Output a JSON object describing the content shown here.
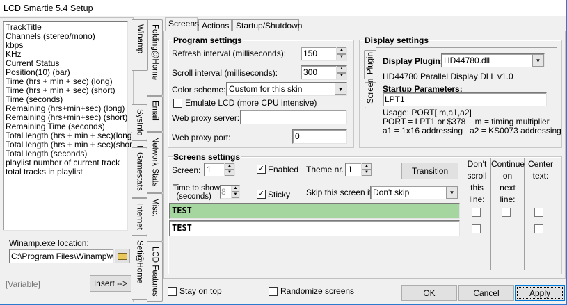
{
  "window": {
    "title": "LCD Smartie 5.4 Setup"
  },
  "left_panel": {
    "variables": [
      "TrackTitle",
      "Channels (stereo/mono)",
      "kbps",
      "KHz",
      "Current Status",
      "Position(10) (bar)",
      "Time (hrs + min + sec) (long)",
      "Time (hrs + min + sec) (short)",
      "Time (seconds)",
      "Remaining (hrs+min+sec) (long)",
      "Remaining (hrs+min+sec) (short)",
      "Remaining Time (seconds)",
      "Total length (hrs + min + sec)(long)",
      "Total length (hrs + min + sec)(short)",
      "Total length (seconds)",
      "playlist number of current track",
      "total tracks in playlist"
    ],
    "exe_label": "Winamp.exe location:",
    "exe_value": "C:\\Program Files\\Winamp\\winamp.exe",
    "variable_placeholder": "[Variable]",
    "insert_label": "Insert -->"
  },
  "side_tabs": {
    "col1": [
      "Winamp",
      "SysInfo",
      "MBM",
      "Gamestats",
      "Internet",
      "Seti@Home"
    ],
    "col2": [
      "Folding@Home",
      "Email",
      "Network Stats",
      "Misc.",
      "LCD Features"
    ],
    "selected": "Winamp"
  },
  "main_tabs": [
    "Screens",
    "Actions",
    "Startup/Shutdown"
  ],
  "program_settings": {
    "title": "Program settings",
    "refresh_label": "Refresh interval (milliseconds):",
    "refresh_value": "150",
    "scroll_label": "Scroll interval (milliseconds):",
    "scroll_value": "300",
    "color_label": "Color scheme:",
    "color_value": "Custom for this skin",
    "emulate_label": "Emulate LCD  (more CPU intensive)",
    "emulate_checked": false,
    "proxy_server_label": "Web proxy server:",
    "proxy_server_value": "",
    "proxy_port_label": "Web proxy port:",
    "proxy_port_value": "0"
  },
  "display_settings": {
    "title": "Display settings",
    "tabs": [
      "Plugin",
      "Screen"
    ],
    "plugin_label": "Display Plugin:",
    "plugin_value": "HD44780.dll",
    "plugin_desc": "HD44780 Parallel Display DLL v1.0",
    "startup_label": "Startup Parameters:",
    "startup_value": "LPT1",
    "usage": [
      "Usage: PORT[,m,a1,a2]",
      "PORT = LPT1 or $378    m = timing multiplier",
      "a1 = 1x16 addressing   a2 = KS0073 addressing"
    ]
  },
  "screens_settings": {
    "title": "Screens settings",
    "screen_label": "Screen:",
    "screen_value": "1",
    "enabled_label": "Enabled",
    "enabled_checked": true,
    "theme_label": "Theme nr.",
    "theme_value": "1",
    "transition_label": "Transition",
    "time_label_1": "Time to show:",
    "time_label_2": "(seconds)",
    "time_value": "8",
    "sticky_label": "Sticky",
    "sticky_checked": true,
    "skip_label": "Skip this screen if:",
    "skip_value": "Don't skip",
    "col_headers": [
      [
        "Don't",
        "scroll",
        "this",
        "line:"
      ],
      [
        "Continue",
        "on",
        "next",
        "line:"
      ],
      [
        "Center",
        "text:"
      ]
    ],
    "lines": [
      "TEST",
      "TEST"
    ],
    "active_line_color": "#a5d6a0"
  },
  "footer": {
    "stay_on_top": "Stay on top",
    "randomize": "Randomize screens",
    "ok": "OK",
    "cancel": "Cancel",
    "apply": "Apply"
  }
}
